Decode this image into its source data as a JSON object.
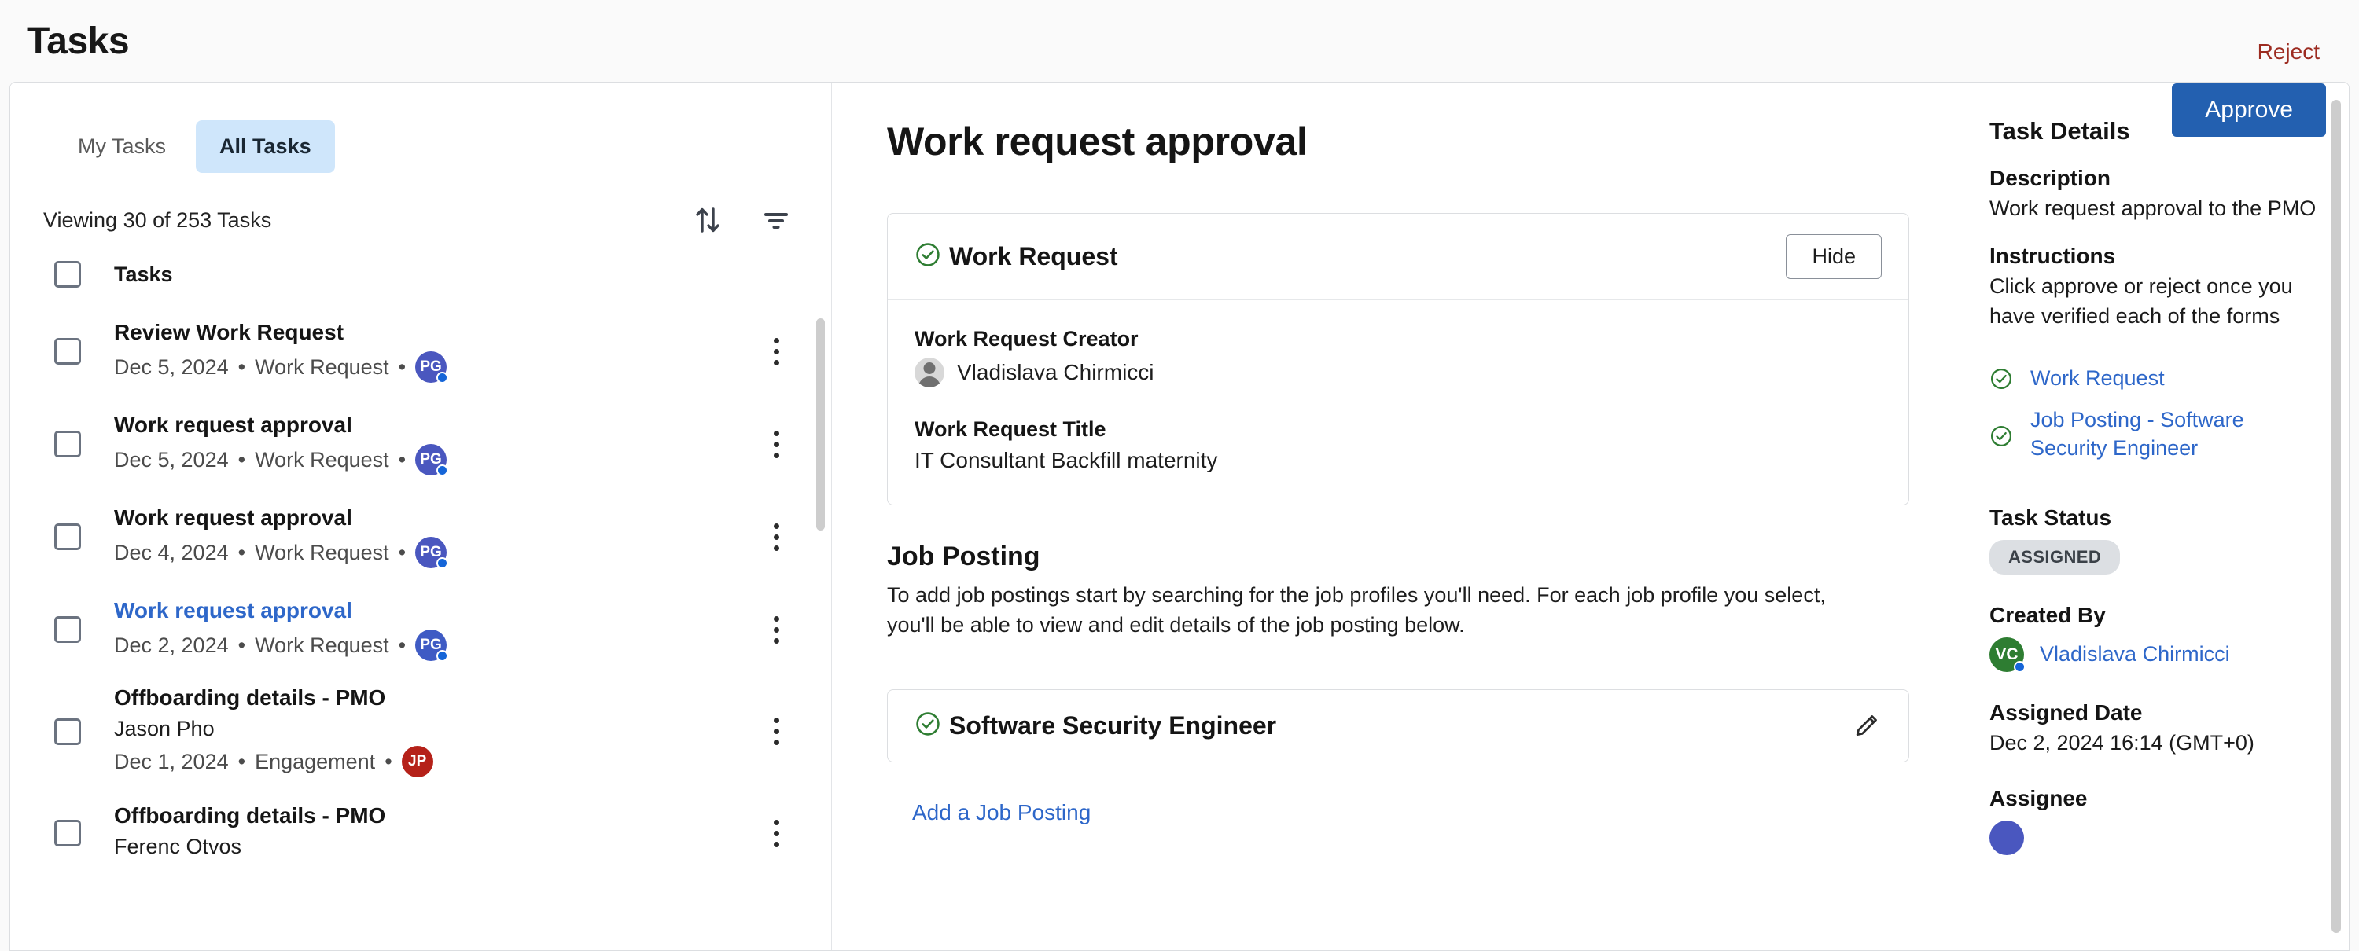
{
  "page": {
    "title": "Tasks"
  },
  "tabs": [
    {
      "label": "My Tasks",
      "active": false
    },
    {
      "label": "All Tasks",
      "active": true
    }
  ],
  "list": {
    "viewing": "Viewing 30 of 253 Tasks",
    "sort_icon": "sort-arrows-icon",
    "filter_icon": "filter-icon",
    "header_label": "Tasks",
    "rows": [
      {
        "title": "Review Work Request",
        "person": "",
        "date": "Dec 5, 2024",
        "type": "Work Request",
        "avatar": "PG",
        "avatar_color": "#4a57bf",
        "selected": false
      },
      {
        "title": "Work request approval",
        "person": "",
        "date": "Dec 5, 2024",
        "type": "Work Request",
        "avatar": "PG",
        "avatar_color": "#4a57bf",
        "selected": false
      },
      {
        "title": "Work request approval",
        "person": "",
        "date": "Dec 4, 2024",
        "type": "Work Request",
        "avatar": "PG",
        "avatar_color": "#4a57bf",
        "selected": false
      },
      {
        "title": "Work request approval",
        "person": "",
        "date": "Dec 2, 2024",
        "type": "Work Request",
        "avatar": "PG",
        "avatar_color": "#3f5bc4",
        "selected": true
      },
      {
        "title": "Offboarding details - PMO",
        "person": "Jason Pho",
        "date": "Dec 1, 2024",
        "type": "Engagement",
        "avatar": "JP",
        "avatar_color": "#b52119",
        "selected": false
      },
      {
        "title": "Offboarding details - PMO",
        "person": "Ferenc Otvos",
        "date": "",
        "type": "",
        "avatar": "",
        "avatar_color": "",
        "selected": false
      }
    ]
  },
  "detail": {
    "title": "Work request approval",
    "reject_label": "Reject",
    "approve_label": "Approve",
    "work_request_card": {
      "title": "Work Request",
      "hide_label": "Hide",
      "creator_label": "Work Request Creator",
      "creator_name": "Vladislava Chirmicci",
      "request_title_label": "Work Request Title",
      "request_title_value": "IT Consultant Backfill maternity"
    },
    "job_posting": {
      "section_title": "Job Posting",
      "section_desc": "To add job postings start by searching for the job profiles you'll need. For each job profile you select, you'll be able to view and edit details of the job posting below.",
      "card_title": "Software Security Engineer",
      "add_link": "Add a Job Posting"
    }
  },
  "side": {
    "title": "Task Details",
    "description_label": "Description",
    "description_value": "Work request approval to the PMO",
    "instructions_label": "Instructions",
    "instructions_value": "Click approve or reject once you have verified each of the forms",
    "links": [
      {
        "label": "Work Request"
      },
      {
        "label": "Job Posting - Software Security Engineer"
      }
    ],
    "task_status_label": "Task Status",
    "task_status_value": "ASSIGNED",
    "created_by_label": "Created By",
    "created_by_name": "Vladislava Chirmicci",
    "created_by_initials": "VC",
    "created_by_color": "#2e7d32",
    "assigned_date_label": "Assigned Date",
    "assigned_date_value": "Dec 2, 2024 16:14 (GMT+0)",
    "assignee_label": "Assignee"
  },
  "colors": {
    "accent_blue": "#2360b0",
    "link_blue": "#2e67c9",
    "reject_red": "#9c2b20",
    "check_green": "#2e7d32",
    "tab_active_bg": "#cfe6fb"
  }
}
